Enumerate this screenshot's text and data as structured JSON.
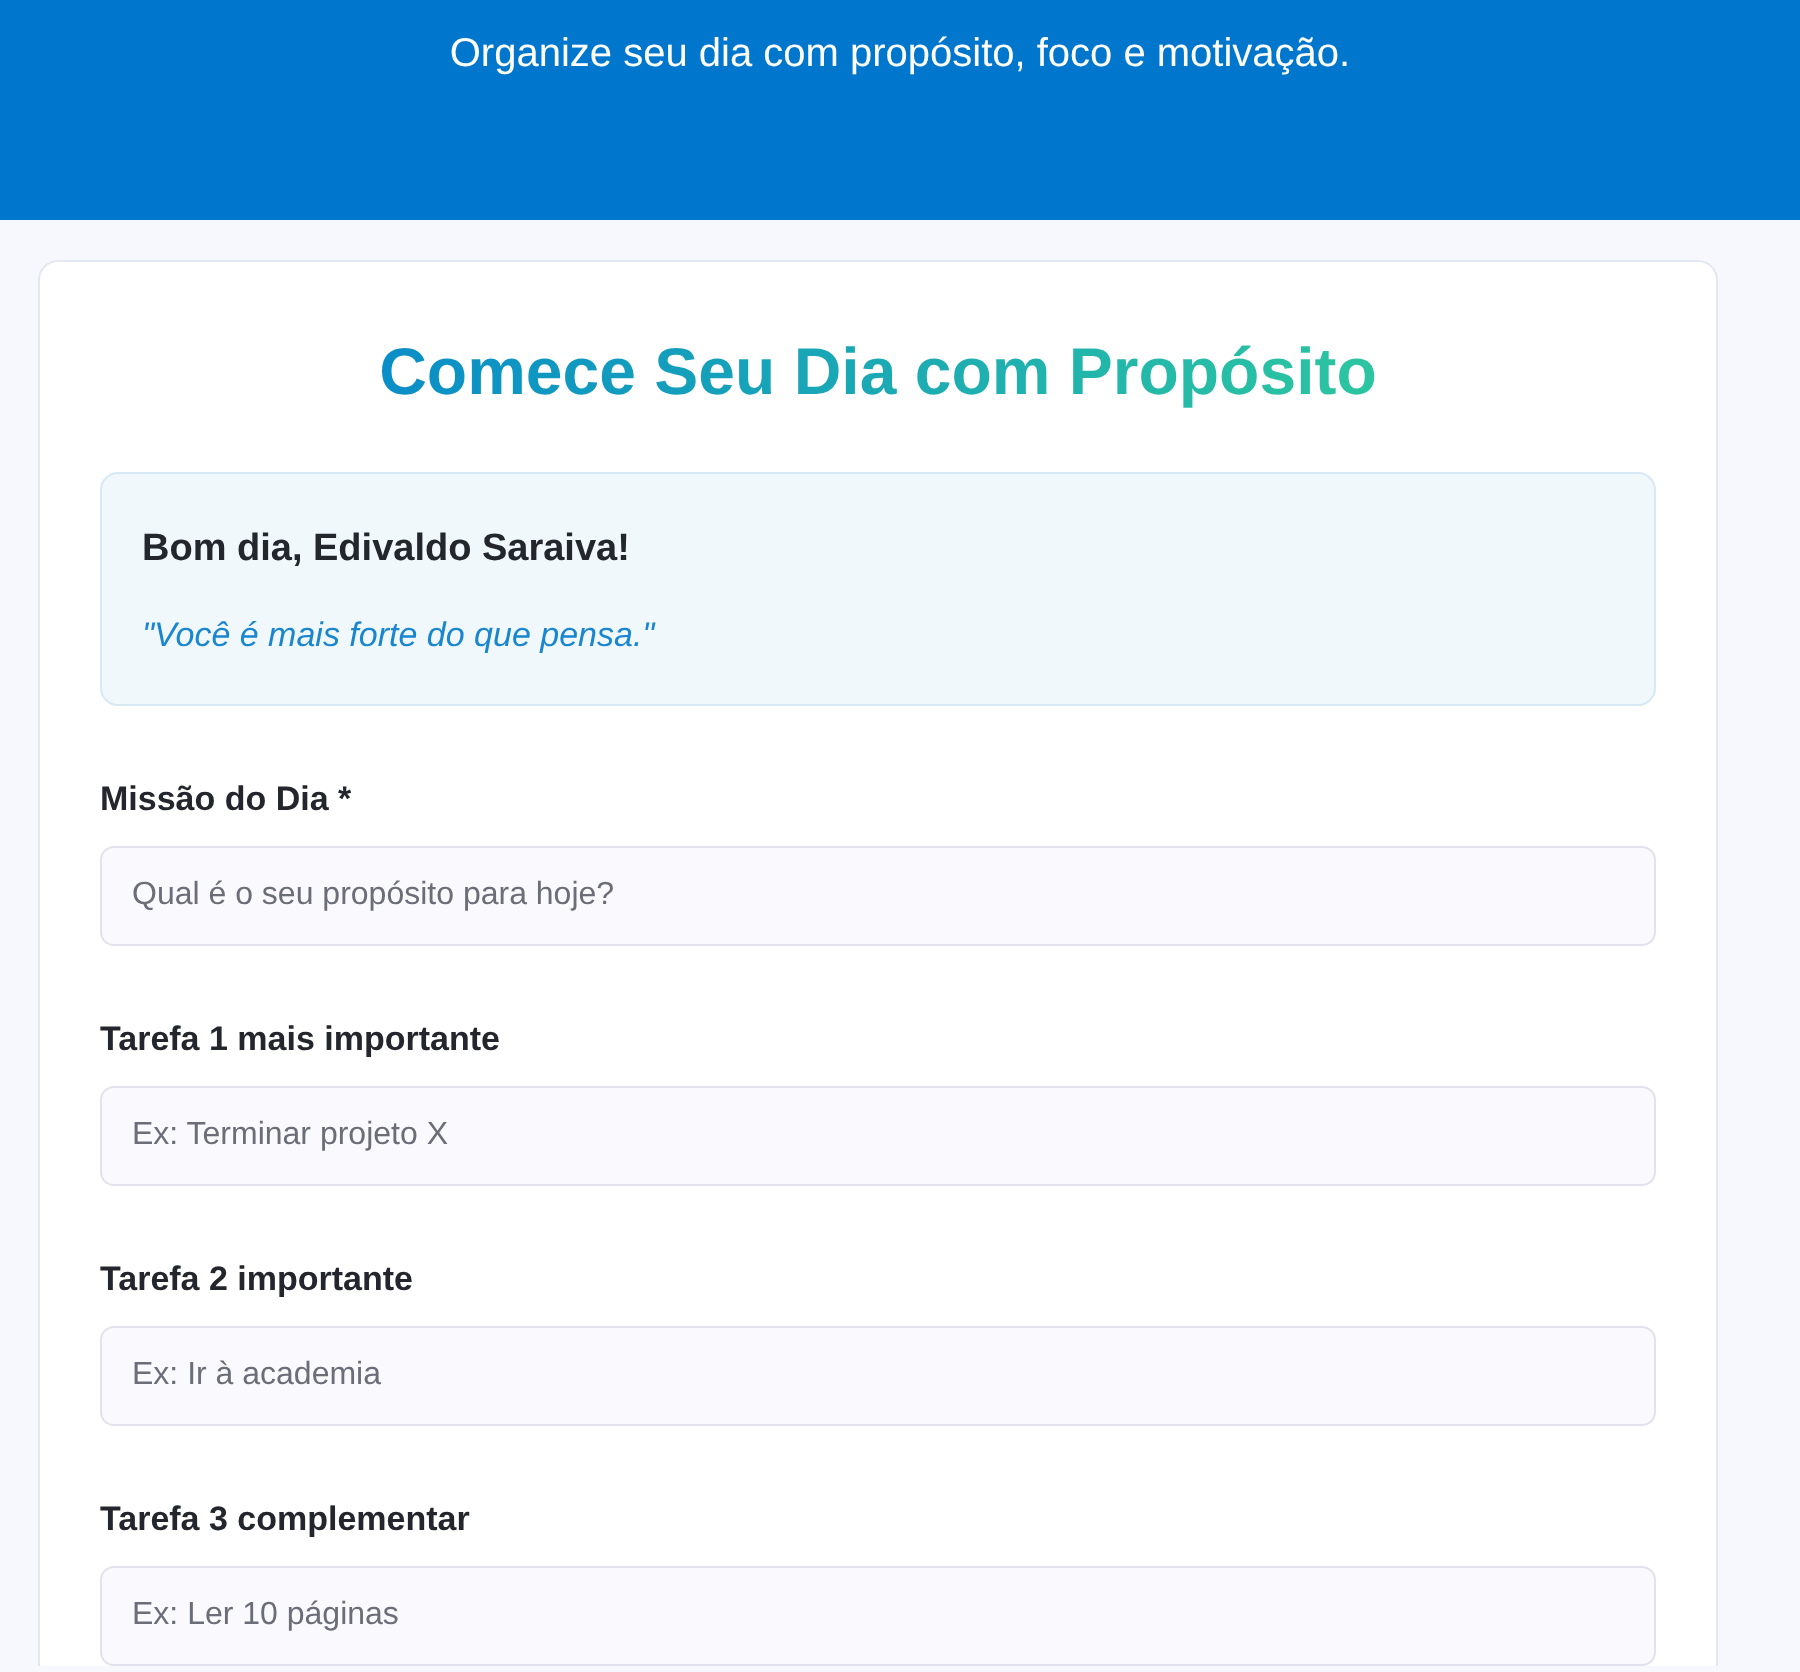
{
  "header": {
    "tagline": "Organize seu dia com propósito, foco e motivação."
  },
  "card": {
    "title": "Comece Seu Dia com Propósito",
    "greeting": {
      "text": "Bom dia, Edivaldo Saraiva!",
      "quote": "\"Você é mais forte do que pensa.\""
    },
    "fields": [
      {
        "label": "Missão do Dia *",
        "placeholder": "Qual é o seu propósito para hoje?"
      },
      {
        "label": "Tarefa 1 mais importante",
        "placeholder": "Ex: Terminar projeto X"
      },
      {
        "label": "Tarefa 2 importante",
        "placeholder": "Ex: Ir à academia"
      },
      {
        "label": "Tarefa 3 complementar",
        "placeholder": "Ex: Ler 10 páginas"
      }
    ]
  }
}
